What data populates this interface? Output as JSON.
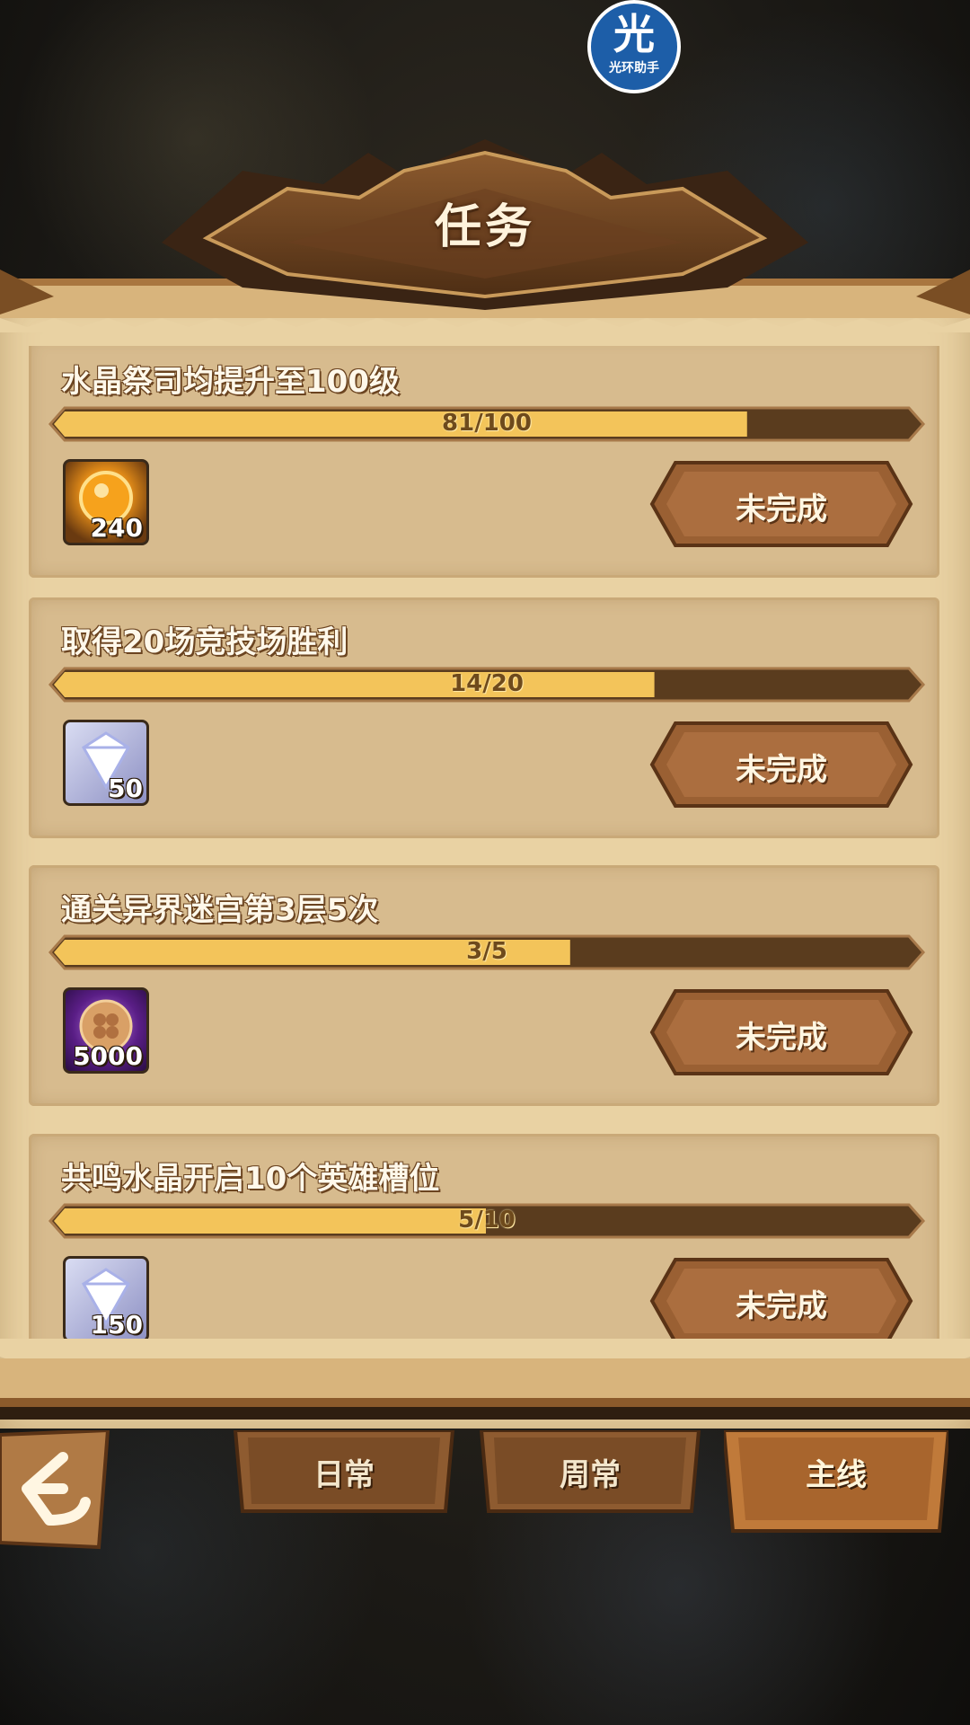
{
  "watermark": {
    "glyph": "光",
    "text": "光环助手"
  },
  "header": {
    "title": "任务"
  },
  "tasks": [
    {
      "title": "水晶祭司均提升至100级",
      "progress_text": "81/100",
      "progress": 0.81,
      "reward_icon": "gold-orb-icon",
      "reward_count": "240",
      "status": "未完成"
    },
    {
      "title": "取得20场竞技场胜利",
      "progress_text": "14/20",
      "progress": 0.7,
      "reward_icon": "diamond-icon",
      "reward_count": "50",
      "status": "未完成"
    },
    {
      "title": "通关异界迷宫第3层5次",
      "progress_text": "3/5",
      "progress": 0.6,
      "reward_icon": "clover-coin-icon",
      "reward_count": "5000",
      "status": "未完成"
    },
    {
      "title": "共鸣水晶开启10个英雄槽位",
      "progress_text": "5/10",
      "progress": 0.5,
      "reward_icon": "diamond-icon",
      "reward_count": "150",
      "status": "未完成"
    }
  ],
  "tabs": [
    {
      "label": "日常",
      "active": false
    },
    {
      "label": "周常",
      "active": false
    },
    {
      "label": "主线",
      "active": true
    }
  ],
  "back": {
    "icon": "back-arrow-icon"
  },
  "colors": {
    "parchment": "#e9d2a3",
    "bar_fill": "#f3c45a",
    "bar_track": "#5a3c1e",
    "button": "#9a6033"
  }
}
